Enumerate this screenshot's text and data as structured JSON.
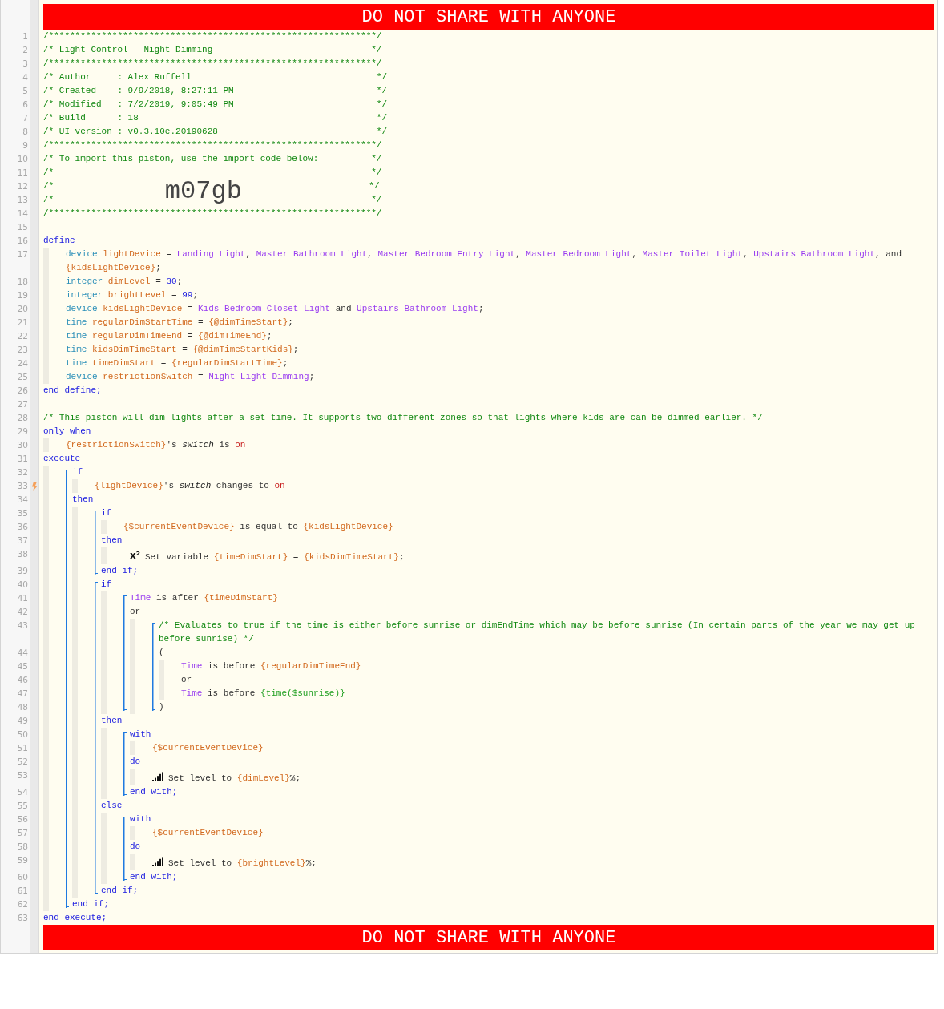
{
  "banner_top": "DO NOT SHARE WITH ANYONE",
  "lines": [
    {
      "kind": "line",
      "number": "1",
      "tokens": [
        {
          "kind": "comment",
          "text": "/**************************************************************/"
        }
      ]
    },
    {
      "kind": "line",
      "number": "2",
      "tokens": [
        {
          "kind": "comment",
          "text": "/* Light Control - Night Dimming                              */"
        }
      ]
    },
    {
      "kind": "line",
      "number": "3",
      "tokens": [
        {
          "kind": "comment",
          "text": "/**************************************************************/"
        }
      ]
    },
    {
      "kind": "line",
      "number": "4",
      "tokens": [
        {
          "kind": "comment",
          "text": "/* Author     : Alex Ruffell                                   */"
        }
      ]
    },
    {
      "kind": "line",
      "number": "5",
      "tokens": [
        {
          "kind": "comment",
          "text": "/* Created    : 9/9/2018, 8:27:11 PM                           */"
        }
      ]
    },
    {
      "kind": "line",
      "number": "6",
      "tokens": [
        {
          "kind": "comment",
          "text": "/* Modified   : 7/2/2019, 9:05:49 PM                           */"
        }
      ]
    },
    {
      "kind": "line",
      "number": "7",
      "tokens": [
        {
          "kind": "comment",
          "text": "/* Build      : 18                                             */"
        }
      ]
    },
    {
      "kind": "line",
      "number": "8",
      "tokens": [
        {
          "kind": "comment",
          "text": "/* UI version : v0.3.10e.20190628                              */"
        }
      ]
    },
    {
      "kind": "line",
      "number": "9",
      "tokens": [
        {
          "kind": "comment",
          "text": "/**************************************************************/"
        }
      ]
    },
    {
      "kind": "line",
      "number": "10",
      "tokens": [
        {
          "kind": "comment",
          "text": "/* To import this piston, use the import code below:          */"
        }
      ]
    },
    {
      "kind": "line",
      "number": "11",
      "tokens": [
        {
          "kind": "comment",
          "text": "/*                                                            */"
        }
      ]
    },
    {
      "kind": "line",
      "number": "12",
      "tokens": [
        {
          "kind": "comment",
          "text": "/*                     "
        },
        {
          "kind": "import_code",
          "text": "m07gb"
        },
        {
          "kind": "comment",
          "text": "                        */"
        }
      ]
    },
    {
      "kind": "line",
      "number": "13",
      "tokens": [
        {
          "kind": "comment",
          "text": "/*                                                            */"
        }
      ]
    },
    {
      "kind": "line",
      "number": "14",
      "tokens": [
        {
          "kind": "comment",
          "text": "/**************************************************************/"
        }
      ]
    },
    {
      "kind": "line",
      "number": "15"
    },
    {
      "kind": "line",
      "number": "16",
      "tokens": [
        {
          "kind": "keyword",
          "text": "define"
        }
      ]
    },
    {
      "kind": "bar",
      "children": [
        {
          "kind": "line",
          "number": "17",
          "tokens": [
            {
              "kind": "type",
              "text": "device"
            },
            {
              "kind": "variable",
              "text": " lightDevice"
            },
            {
              "kind": "plain",
              "text": " = "
            },
            {
              "kind": "device",
              "text": "Landing Light"
            },
            {
              "kind": "plain",
              "text": ", "
            },
            {
              "kind": "device",
              "text": "Master Bathroom Light"
            },
            {
              "kind": "plain",
              "text": ", "
            },
            {
              "kind": "device",
              "text": "Master Bedroom Entry Light"
            },
            {
              "kind": "plain",
              "text": ", "
            },
            {
              "kind": "device",
              "text": "Master Bedroom Light"
            },
            {
              "kind": "plain",
              "text": ", "
            },
            {
              "kind": "device",
              "text": "Master Toilet Light"
            },
            {
              "kind": "plain",
              "text": ", "
            },
            {
              "kind": "device",
              "text": "Upstairs Bathroom Light"
            },
            {
              "kind": "plain",
              "text": ", and "
            },
            {
              "kind": "variable",
              "text": "{kidsLightDevice}"
            },
            {
              "kind": "plain",
              "text": ";"
            }
          ]
        },
        {
          "kind": "line",
          "number": "18",
          "tokens": [
            {
              "kind": "type",
              "text": "integer"
            },
            {
              "kind": "variable",
              "text": " dimLevel"
            },
            {
              "kind": "plain",
              "text": " = "
            },
            {
              "kind": "number",
              "text": "30"
            },
            {
              "kind": "plain",
              "text": ";"
            }
          ]
        },
        {
          "kind": "line",
          "number": "19",
          "tokens": [
            {
              "kind": "type",
              "text": "integer"
            },
            {
              "kind": "variable",
              "text": " brightLevel"
            },
            {
              "kind": "plain",
              "text": " = "
            },
            {
              "kind": "number",
              "text": "99"
            },
            {
              "kind": "plain",
              "text": ";"
            }
          ]
        },
        {
          "kind": "line",
          "number": "20",
          "tokens": [
            {
              "kind": "type",
              "text": "device"
            },
            {
              "kind": "variable",
              "text": " kidsLightDevice"
            },
            {
              "kind": "plain",
              "text": " = "
            },
            {
              "kind": "device",
              "text": "Kids Bedroom Closet Light"
            },
            {
              "kind": "plain",
              "text": " and "
            },
            {
              "kind": "device",
              "text": "Upstairs Bathroom Light"
            },
            {
              "kind": "plain",
              "text": ";"
            }
          ]
        },
        {
          "kind": "line",
          "number": "21",
          "tokens": [
            {
              "kind": "type",
              "text": "time"
            },
            {
              "kind": "variable",
              "text": " regularDimStartTime"
            },
            {
              "kind": "plain",
              "text": " = "
            },
            {
              "kind": "variable",
              "text": "{@dimTimeStart}"
            },
            {
              "kind": "plain",
              "text": ";"
            }
          ]
        },
        {
          "kind": "line",
          "number": "22",
          "tokens": [
            {
              "kind": "type",
              "text": "time"
            },
            {
              "kind": "variable",
              "text": " regularDimTimeEnd"
            },
            {
              "kind": "plain",
              "text": " = "
            },
            {
              "kind": "variable",
              "text": "{@dimTimeEnd}"
            },
            {
              "kind": "plain",
              "text": ";"
            }
          ]
        },
        {
          "kind": "line",
          "number": "23",
          "tokens": [
            {
              "kind": "type",
              "text": "time"
            },
            {
              "kind": "variable",
              "text": " kidsDimTimeStart"
            },
            {
              "kind": "plain",
              "text": " = "
            },
            {
              "kind": "variable",
              "text": "{@dimTimeStartKids}"
            },
            {
              "kind": "plain",
              "text": ";"
            }
          ]
        },
        {
          "kind": "line",
          "number": "24",
          "tokens": [
            {
              "kind": "type",
              "text": "time"
            },
            {
              "kind": "variable",
              "text": " timeDimStart"
            },
            {
              "kind": "plain",
              "text": " = "
            },
            {
              "kind": "variable",
              "text": "{regularDimStartTime}"
            },
            {
              "kind": "plain",
              "text": ";"
            }
          ]
        },
        {
          "kind": "line",
          "number": "25",
          "tokens": [
            {
              "kind": "type",
              "text": "device"
            },
            {
              "kind": "variable",
              "text": " restrictionSwitch"
            },
            {
              "kind": "plain",
              "text": " = "
            },
            {
              "kind": "device",
              "text": "Night Light Dimming"
            },
            {
              "kind": "plain",
              "text": ";"
            }
          ]
        }
      ]
    },
    {
      "kind": "line",
      "number": "26",
      "tokens": [
        {
          "kind": "keyword",
          "text": "end define;"
        }
      ]
    },
    {
      "kind": "line",
      "number": "27"
    },
    {
      "kind": "line",
      "number": "28",
      "tokens": [
        {
          "kind": "comment",
          "text": "/* This piston will dim lights after a set time. It supports two different zones so that lights where kids are can be dimmed earlier. */"
        }
      ]
    },
    {
      "kind": "line",
      "number": "29",
      "tokens": [
        {
          "kind": "keyword",
          "text": "only when"
        }
      ]
    },
    {
      "kind": "bar",
      "children": [
        {
          "kind": "line",
          "number": "30",
          "tokens": [
            {
              "kind": "variable",
              "text": "{restrictionSwitch}"
            },
            {
              "kind": "plain",
              "text": "'s "
            },
            {
              "kind": "italic",
              "text": "switch"
            },
            {
              "kind": "plain",
              "text": " is "
            },
            {
              "kind": "value",
              "text": "on"
            }
          ]
        }
      ]
    },
    {
      "kind": "line",
      "number": "31",
      "tokens": [
        {
          "kind": "keyword",
          "text": "execute"
        }
      ]
    },
    {
      "kind": "bar",
      "children": [
        {
          "kind": "bracket",
          "children": [
            {
              "kind": "line",
              "number": "32",
              "tokens": [
                {
                  "kind": "keyword",
                  "text": "if"
                }
              ]
            },
            {
              "kind": "bar",
              "children": [
                {
                  "kind": "trigger_line",
                  "number": "33",
                  "tokens": [
                    {
                      "kind": "variable",
                      "text": "{lightDevice}"
                    },
                    {
                      "kind": "plain",
                      "text": "'s "
                    },
                    {
                      "kind": "italic",
                      "text": "switch"
                    },
                    {
                      "kind": "plain",
                      "text": " changes to "
                    },
                    {
                      "kind": "value",
                      "text": "on"
                    }
                  ]
                }
              ]
            },
            {
              "kind": "line",
              "number": "34",
              "tokens": [
                {
                  "kind": "keyword",
                  "text": "then"
                }
              ]
            },
            {
              "kind": "bar",
              "children": [
                {
                  "kind": "bracket",
                  "children": [
                    {
                      "kind": "line",
                      "number": "35",
                      "tokens": [
                        {
                          "kind": "keyword",
                          "text": "if"
                        }
                      ]
                    },
                    {
                      "kind": "bar",
                      "children": [
                        {
                          "kind": "line",
                          "number": "36",
                          "tokens": [
                            {
                              "kind": "variable",
                              "text": "{$currentEventDevice}"
                            },
                            {
                              "kind": "plain",
                              "text": " is equal to "
                            },
                            {
                              "kind": "variable",
                              "text": "{kidsLightDevice}"
                            }
                          ]
                        }
                      ]
                    },
                    {
                      "kind": "line",
                      "number": "37",
                      "tokens": [
                        {
                          "kind": "keyword",
                          "text": "then"
                        }
                      ]
                    },
                    {
                      "kind": "bar",
                      "children": [
                        {
                          "kind": "line",
                          "number": "38",
                          "tokens": [
                            {
                              "kind": "superscript_icon",
                              "text": "x²"
                            },
                            {
                              "kind": "plain",
                              "text": "Set variable "
                            },
                            {
                              "kind": "variable",
                              "text": "{timeDimStart}"
                            },
                            {
                              "kind": "plain",
                              "text": " = "
                            },
                            {
                              "kind": "variable",
                              "text": "{kidsDimTimeStart}"
                            },
                            {
                              "kind": "plain",
                              "text": ";"
                            }
                          ]
                        }
                      ]
                    },
                    {
                      "kind": "line",
                      "number": "39",
                      "tokens": [
                        {
                          "kind": "keyword",
                          "text": "end if;"
                        }
                      ]
                    }
                  ]
                },
                {
                  "kind": "bracket",
                  "children": [
                    {
                      "kind": "line",
                      "number": "40",
                      "tokens": [
                        {
                          "kind": "keyword",
                          "text": "if"
                        }
                      ]
                    },
                    {
                      "kind": "bar",
                      "children": [
                        {
                          "kind": "bracket",
                          "children": [
                            {
                              "kind": "line",
                              "number": "41",
                              "tokens": [
                                {
                                  "kind": "device",
                                  "text": "Time"
                                },
                                {
                                  "kind": "plain",
                                  "text": " is after "
                                },
                                {
                                  "kind": "variable",
                                  "text": "{timeDimStart}"
                                }
                              ]
                            },
                            {
                              "kind": "line",
                              "number": "42",
                              "tokens": [
                                {
                                  "kind": "plain",
                                  "text": "or"
                                }
                              ]
                            },
                            {
                              "kind": "bar",
                              "children": [
                                {
                                  "kind": "bracket",
                                  "children": [
                                    {
                                      "kind": "line",
                                      "number": "43",
                                      "tokens": [
                                        {
                                          "kind": "comment",
                                          "text": "/* Evaluates to true if the time is either before sunrise or dimEndTime which may be before sunrise (In certain parts of the year we may get up before sunrise) */"
                                        }
                                      ]
                                    },
                                    {
                                      "kind": "line",
                                      "number": "44",
                                      "tokens": [
                                        {
                                          "kind": "plain",
                                          "text": "("
                                        }
                                      ]
                                    },
                                    {
                                      "kind": "bar",
                                      "children": [
                                        {
                                          "kind": "line",
                                          "number": "45",
                                          "tokens": [
                                            {
                                              "kind": "device",
                                              "text": "Time"
                                            },
                                            {
                                              "kind": "plain",
                                              "text": " is before "
                                            },
                                            {
                                              "kind": "variable",
                                              "text": "{regularDimTimeEnd}"
                                            }
                                          ]
                                        },
                                        {
                                          "kind": "line",
                                          "number": "46",
                                          "tokens": [
                                            {
                                              "kind": "plain",
                                              "text": "or"
                                            }
                                          ]
                                        },
                                        {
                                          "kind": "line",
                                          "number": "47",
                                          "tokens": [
                                            {
                                              "kind": "device",
                                              "text": "Time"
                                            },
                                            {
                                              "kind": "plain",
                                              "text": " is before "
                                            },
                                            {
                                              "kind": "function",
                                              "text": "{time($sunrise)}"
                                            }
                                          ]
                                        }
                                      ]
                                    },
                                    {
                                      "kind": "line",
                                      "number": "48",
                                      "tokens": [
                                        {
                                          "kind": "plain",
                                          "text": ")"
                                        }
                                      ]
                                    }
                                  ]
                                }
                              ]
                            }
                          ]
                        }
                      ]
                    },
                    {
                      "kind": "line",
                      "number": "49",
                      "tokens": [
                        {
                          "kind": "keyword",
                          "text": "then"
                        }
                      ]
                    },
                    {
                      "kind": "bar",
                      "children": [
                        {
                          "kind": "bracket",
                          "children": [
                            {
                              "kind": "line",
                              "number": "50",
                              "tokens": [
                                {
                                  "kind": "keyword",
                                  "text": "with"
                                }
                              ]
                            },
                            {
                              "kind": "bar",
                              "children": [
                                {
                                  "kind": "line",
                                  "number": "51",
                                  "tokens": [
                                    {
                                      "kind": "variable",
                                      "text": "{$currentEventDevice}"
                                    }
                                  ]
                                }
                              ]
                            },
                            {
                              "kind": "line",
                              "number": "52",
                              "tokens": [
                                {
                                  "kind": "keyword",
                                  "text": "do"
                                }
                              ]
                            },
                            {
                              "kind": "bar",
                              "children": [
                                {
                                  "kind": "level_line",
                                  "number": "53",
                                  "tokens": [
                                    {
                                      "kind": "plain",
                                      "text": "Set level to "
                                    },
                                    {
                                      "kind": "variable",
                                      "text": "{dimLevel}"
                                    },
                                    {
                                      "kind": "plain",
                                      "text": "%;"
                                    }
                                  ]
                                }
                              ]
                            },
                            {
                              "kind": "line",
                              "number": "54",
                              "tokens": [
                                {
                                  "kind": "keyword",
                                  "text": "end with;"
                                }
                              ]
                            }
                          ]
                        }
                      ]
                    },
                    {
                      "kind": "line",
                      "number": "55",
                      "tokens": [
                        {
                          "kind": "keyword",
                          "text": "else"
                        }
                      ]
                    },
                    {
                      "kind": "bar",
                      "children": [
                        {
                          "kind": "bracket",
                          "children": [
                            {
                              "kind": "line",
                              "number": "56",
                              "tokens": [
                                {
                                  "kind": "keyword",
                                  "text": "with"
                                }
                              ]
                            },
                            {
                              "kind": "bar",
                              "children": [
                                {
                                  "kind": "line",
                                  "number": "57",
                                  "tokens": [
                                    {
                                      "kind": "variable",
                                      "text": "{$currentEventDevice}"
                                    }
                                  ]
                                }
                              ]
                            },
                            {
                              "kind": "line",
                              "number": "58",
                              "tokens": [
                                {
                                  "kind": "keyword",
                                  "text": "do"
                                }
                              ]
                            },
                            {
                              "kind": "bar",
                              "children": [
                                {
                                  "kind": "level_line",
                                  "number": "59",
                                  "tokens": [
                                    {
                                      "kind": "plain",
                                      "text": "Set level to "
                                    },
                                    {
                                      "kind": "variable",
                                      "text": "{brightLevel}"
                                    },
                                    {
                                      "kind": "plain",
                                      "text": "%;"
                                    }
                                  ]
                                }
                              ]
                            },
                            {
                              "kind": "line",
                              "number": "60",
                              "tokens": [
                                {
                                  "kind": "keyword",
                                  "text": "end with;"
                                }
                              ]
                            }
                          ]
                        }
                      ]
                    },
                    {
                      "kind": "line",
                      "number": "61",
                      "tokens": [
                        {
                          "kind": "keyword",
                          "text": "end if;"
                        }
                      ]
                    }
                  ]
                }
              ]
            },
            {
              "kind": "line",
              "number": "62",
              "tokens": [
                {
                  "kind": "keyword",
                  "text": "end if;"
                }
              ]
            }
          ]
        }
      ]
    },
    {
      "kind": "line",
      "number": "63",
      "tokens": [
        {
          "kind": "keyword",
          "text": "end execute;"
        }
      ]
    }
  ],
  "banner_bottom": "DO NOT SHARE WITH ANYONE"
}
